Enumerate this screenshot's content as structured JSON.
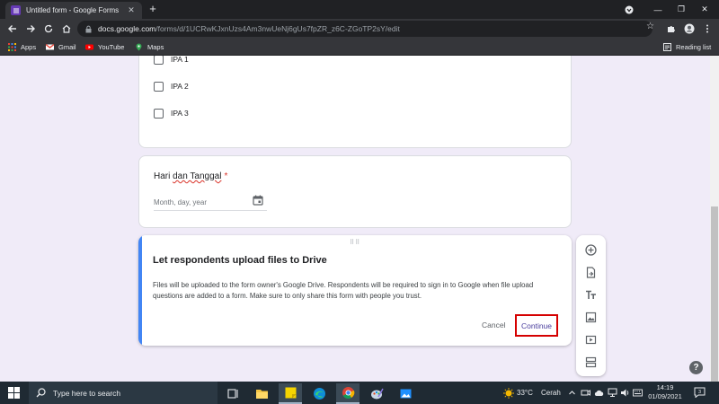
{
  "browser": {
    "tab_title": "Untitled form - Google Forms",
    "url_domain": "docs.google.com",
    "url_path": "/forms/d/1UCRwKJxnUzs4Am3nwUeNj6gUs7fpZR_z6C-ZGoTP2sY/edit",
    "bookmarks": [
      "Apps",
      "Gmail",
      "YouTube",
      "Maps"
    ],
    "reading_list": "Reading list"
  },
  "form": {
    "options": [
      "IPA 1",
      "IPA 2",
      "IPA 3"
    ],
    "date_question": {
      "title_prefix": "Hari ",
      "title_underlined": "dan Tanggal",
      "required_mark": "*",
      "placeholder": "Month, day, year"
    }
  },
  "dialog": {
    "title": "Let respondents upload files to Drive",
    "body": "Files will be uploaded to the form owner's Google Drive. Respondents will be required to sign in to Google when file upload questions are added to a form. Make sure to only share this form with people you trust.",
    "cancel_label": "Cancel",
    "continue_label": "Continue"
  },
  "side_toolbar": {
    "icons": [
      "add-question-icon",
      "import-questions-icon",
      "add-title-icon",
      "add-image-icon",
      "add-video-icon",
      "add-section-icon"
    ]
  },
  "taskbar": {
    "search_placeholder": "Type here to search",
    "weather_temp": "33°C",
    "weather_desc": "Cerah",
    "time": "14:19",
    "date": "01/09/2021"
  },
  "colors": {
    "form_bg": "#f0ebf8",
    "accent_blue": "#4285f4",
    "continue_highlight": "#d50000",
    "required_red": "#d93025"
  }
}
